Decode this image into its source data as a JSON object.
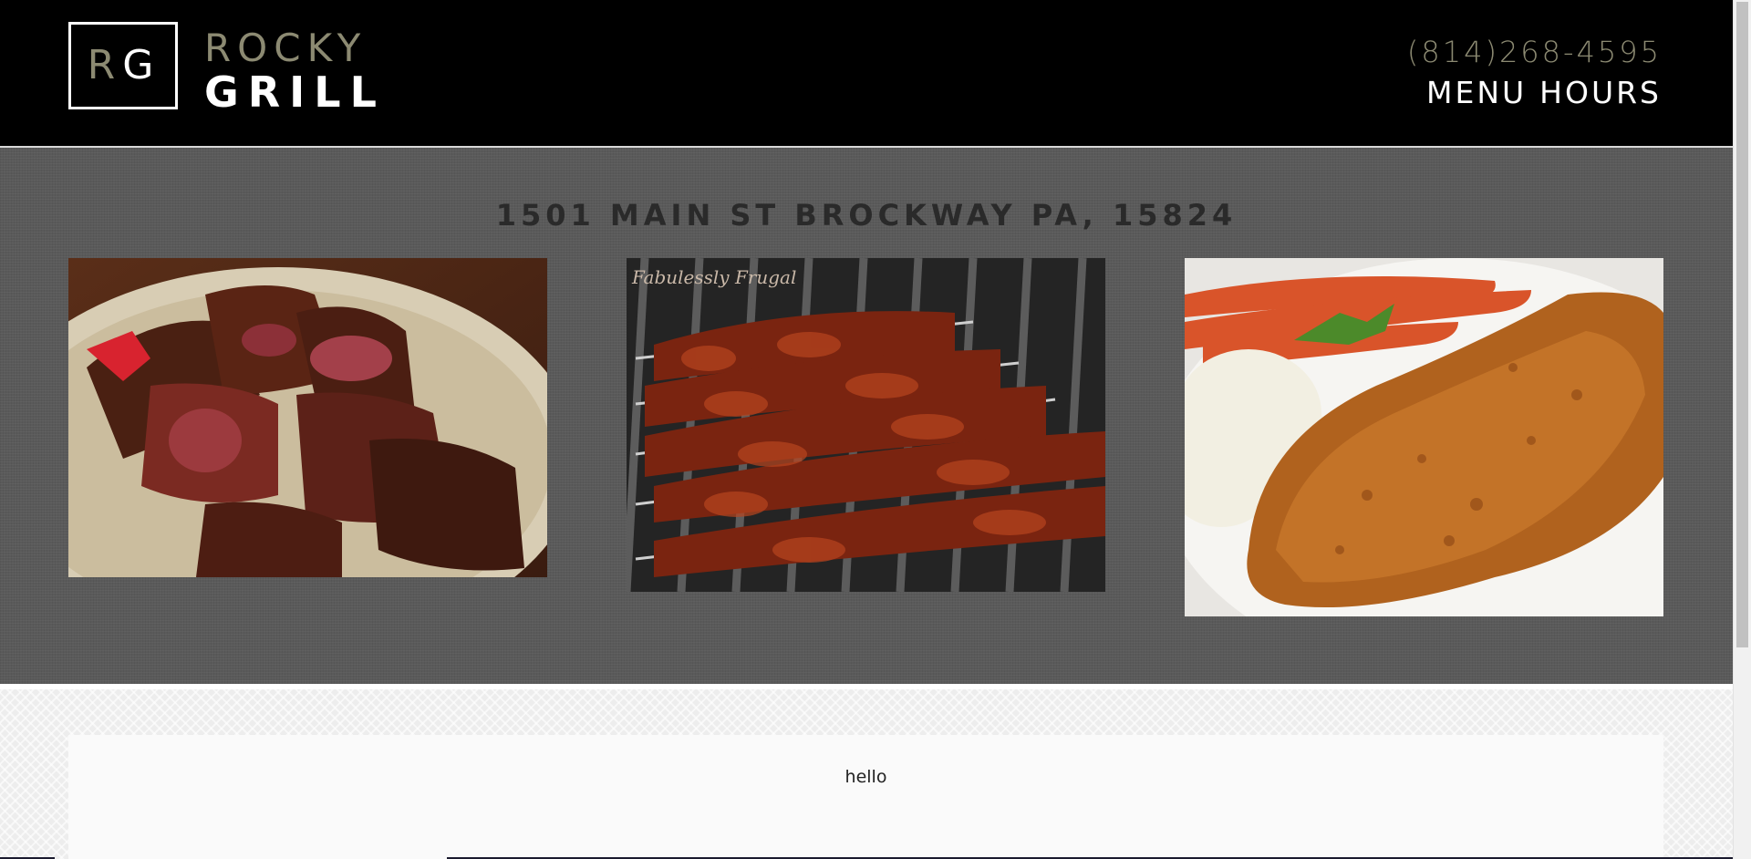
{
  "header": {
    "logo": {
      "letter_r": "R",
      "letter_g": "G"
    },
    "brand_top": "ROCKY",
    "brand_bottom": "GRILL",
    "phone": "(814)268-4595",
    "nav": [
      {
        "label": "MENU"
      },
      {
        "label": "HOURS"
      }
    ]
  },
  "hero": {
    "address": "1501 MAIN ST BROCKWAY PA, 15824",
    "photos": [
      {
        "subject": "sliced grilled steak on a plate",
        "watermark": ""
      },
      {
        "subject": "barbecue chicken skewers on a grill",
        "watermark": "Fabulessly Frugal"
      },
      {
        "subject": "fried fish fillet with mashed potatoes and carrots",
        "watermark": ""
      }
    ]
  },
  "content": {
    "text": "hello"
  },
  "colors": {
    "header_bg": "#000000",
    "accent_khaki": "#8c8a72",
    "hero_bg": "#5a5a5a",
    "address_text": "#2a2a2a"
  }
}
